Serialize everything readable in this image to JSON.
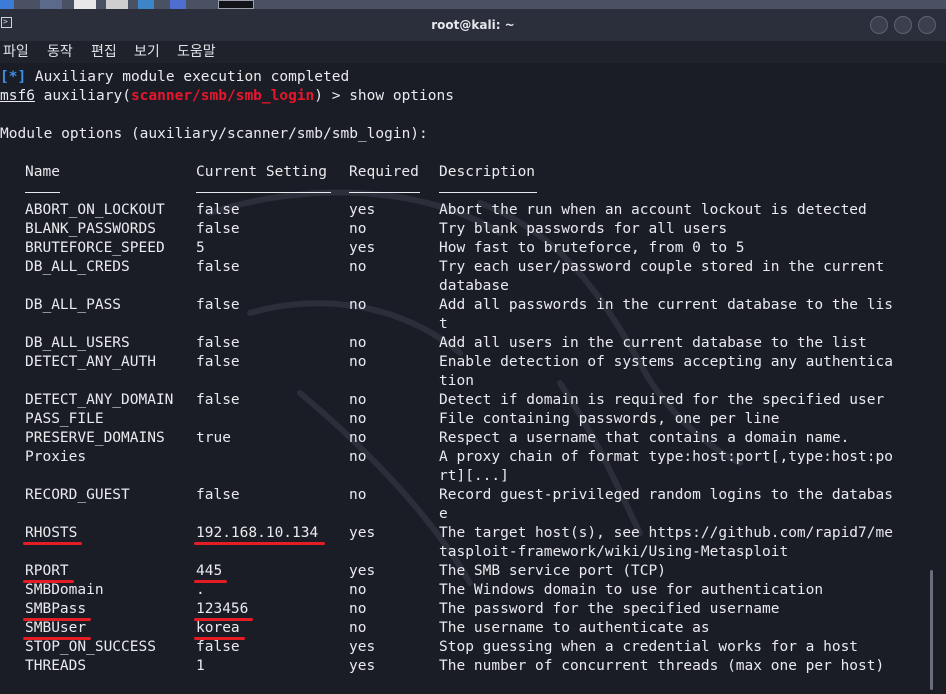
{
  "window": {
    "title": "root@kali: ~"
  },
  "menu": [
    "파일",
    "동작",
    "편집",
    "보기",
    "도움말"
  ],
  "output": {
    "status_marker": "[*]",
    "status_text": " Auxiliary module execution completed",
    "prompt_name": "msf6",
    "prompt_mid": " auxiliary(",
    "module_path": "scanner/smb/smb_login",
    "prompt_end": ") > show options",
    "options_heading": "Module options (auxiliary/scanner/smb/smb_login):"
  },
  "table": {
    "headers": {
      "name": "Name",
      "setting": "Current Setting",
      "required": "Required",
      "description": "Description"
    },
    "rows": [
      {
        "name": "ABORT_ON_LOCKOUT",
        "setting": "false",
        "required": "yes",
        "desc": [
          "Abort the run when an account lockout is detected"
        ]
      },
      {
        "name": "BLANK_PASSWORDS",
        "setting": "false",
        "required": "no",
        "desc": [
          "Try blank passwords for all users"
        ]
      },
      {
        "name": "BRUTEFORCE_SPEED",
        "setting": "5",
        "required": "yes",
        "desc": [
          "How fast to bruteforce, from 0 to 5"
        ]
      },
      {
        "name": "DB_ALL_CREDS",
        "setting": "false",
        "required": "no",
        "desc": [
          "Try each user/password couple stored in the current",
          "database"
        ]
      },
      {
        "name": "DB_ALL_PASS",
        "setting": "false",
        "required": "no",
        "desc": [
          "Add all passwords in the current database to the lis",
          "t"
        ]
      },
      {
        "name": "DB_ALL_USERS",
        "setting": "false",
        "required": "no",
        "desc": [
          "Add all users in the current database to the list"
        ]
      },
      {
        "name": "DETECT_ANY_AUTH",
        "setting": "false",
        "required": "no",
        "desc": [
          "Enable detection of systems accepting any authentica",
          "tion"
        ]
      },
      {
        "name": "DETECT_ANY_DOMAIN",
        "setting": "false",
        "required": "no",
        "desc": [
          "Detect if domain is required for the specified user"
        ]
      },
      {
        "name": "PASS_FILE",
        "setting": "",
        "required": "no",
        "desc": [
          "File containing passwords, one per line"
        ]
      },
      {
        "name": "PRESERVE_DOMAINS",
        "setting": "true",
        "required": "no",
        "desc": [
          "Respect a username that contains a domain name."
        ]
      },
      {
        "name": "Proxies",
        "setting": "",
        "required": "no",
        "desc": [
          "A proxy chain of format type:host:port[,type:host:po",
          "rt][...]"
        ]
      },
      {
        "name": "RECORD_GUEST",
        "setting": "false",
        "required": "no",
        "desc": [
          "Record guest-privileged random logins to the databas",
          "e"
        ]
      },
      {
        "name": "RHOSTS",
        "setting": "192.168.10.134",
        "required": "yes",
        "desc": [
          "The target host(s), see https://github.com/rapid7/me",
          "tasploit-framework/wiki/Using-Metasploit"
        ],
        "marked": true
      },
      {
        "name": "RPORT",
        "setting": "445",
        "required": "yes",
        "desc": [
          "The SMB service port (TCP)"
        ],
        "marked": true
      },
      {
        "name": "SMBDomain",
        "setting": ".",
        "required": "no",
        "desc": [
          "The Windows domain to use for authentication"
        ]
      },
      {
        "name": "SMBPass",
        "setting": "123456",
        "required": "no",
        "desc": [
          "The password for the specified username"
        ],
        "marked": true
      },
      {
        "name": "SMBUser",
        "setting": "korea",
        "required": "no",
        "desc": [
          "The username to authenticate as"
        ],
        "marked": true
      },
      {
        "name": "STOP_ON_SUCCESS",
        "setting": "false",
        "required": "yes",
        "desc": [
          "Stop guessing when a credential works for a host"
        ]
      },
      {
        "name": "THREADS",
        "setting": "1",
        "required": "yes",
        "desc": [
          "The number of concurrent threads (max one per host)"
        ]
      }
    ]
  },
  "colors": {
    "prompt_blue": "#3b8eea",
    "module_red": "#e8162b",
    "annotation_red": "#e41c24",
    "terminal_bg": "#1b1d26"
  }
}
